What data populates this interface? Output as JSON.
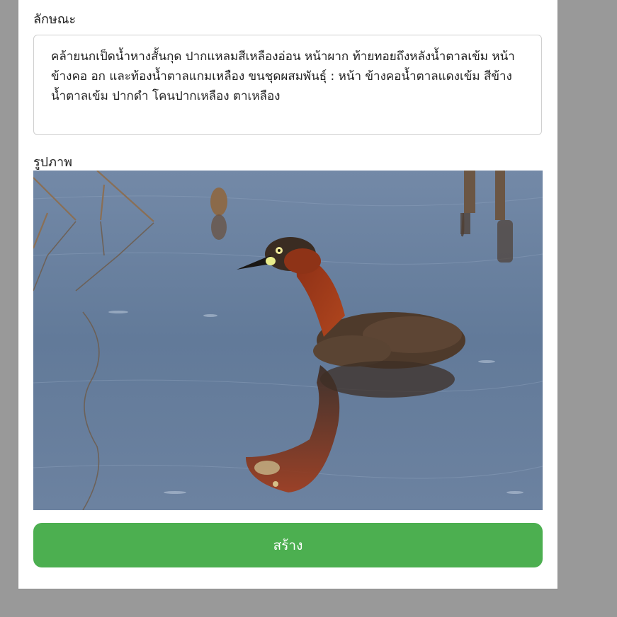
{
  "form": {
    "description_label": "ลักษณะ",
    "description_text": "คล้ายนกเป็ดน้ำหางสั้นกุด ปากแหลมสีเหลืองอ่อน หน้าผาก ท้ายทอยถึงหลังน้ำตาลเข้ม หน้าข้างคอ อก และท้องน้ำตาลแกมเหลือง  ขนชุดผสมพันธุ์ : หน้า ข้างคอน้ำตาลแดงเข้ม สีข้างน้ำตาลเข้ม ปากดำ โคนปากเหลือง ตาเหลือง",
    "image_label": "รูปภาพ",
    "create_button_label": "สร้าง"
  },
  "colors": {
    "page_background": "#999999",
    "panel": "#ffffff",
    "button": "#4caf50",
    "water": "#5e7593"
  }
}
